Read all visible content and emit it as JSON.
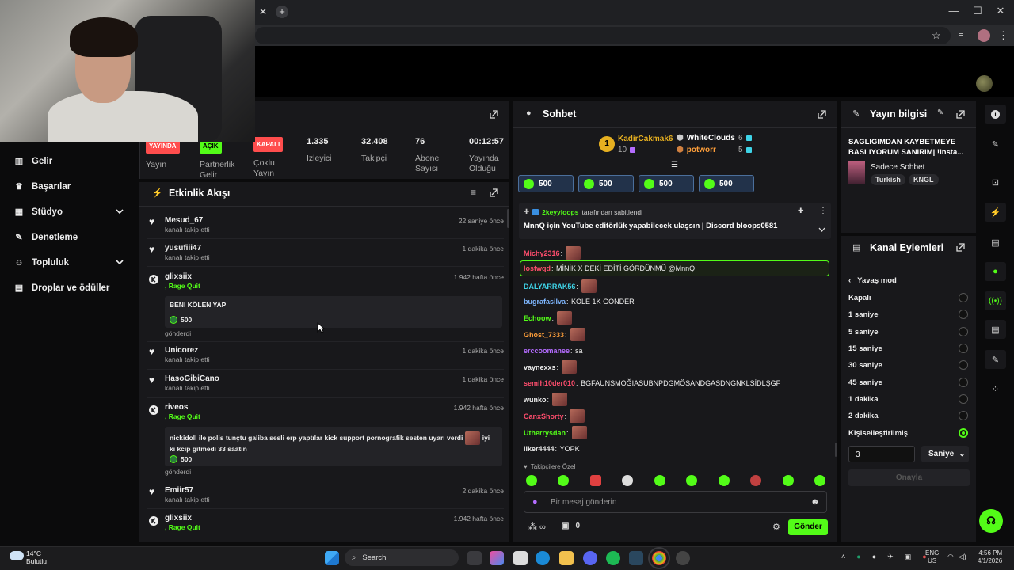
{
  "colors": {
    "accent": "#53fc18",
    "panel": "#18181b",
    "bg": "#0b0b0c"
  },
  "sidebar": {
    "items": [
      {
        "label": "Gelir",
        "icon": "bar-chart-icon"
      },
      {
        "label": "Başarılar",
        "icon": "trophy-icon"
      },
      {
        "label": "Stüdyo",
        "icon": "layout-icon"
      },
      {
        "label": "Denetleme",
        "icon": "wrench-icon"
      },
      {
        "label": "Topluluk",
        "icon": "people-icon"
      },
      {
        "label": "Droplar ve ödüller",
        "icon": "gift-icon"
      }
    ]
  },
  "stats": {
    "items": [
      {
        "badge": "YAYINDA",
        "label": "Yayın"
      },
      {
        "badge": "AÇIK",
        "label": "Partnerlik Gelir"
      },
      {
        "badge": "KAPALI",
        "label": "Çoklu Yayın"
      },
      {
        "value": "1.335",
        "label": "İzleyici"
      },
      {
        "value": "32.408",
        "label": "Takipçi"
      },
      {
        "value": "76",
        "label": "Abone Sayısı"
      },
      {
        "value": "00:12:57",
        "label": "Yayında Olduğu"
      }
    ]
  },
  "events": {
    "title": "Etkinlik Akışı",
    "items": [
      {
        "user": "Mesud_67",
        "action": "kanalı takip etti",
        "time": "22 saniye önce"
      },
      {
        "user": "yusufiii47",
        "action": "kanalı takip etti",
        "time": "1 dakika önce"
      },
      {
        "user": "glixsiix",
        "action": ", Rage Quit",
        "time": "1.942 hafta önce",
        "message": "BENİ KÖLEN YAP",
        "amount": "500",
        "sent": "gönderdi"
      },
      {
        "user": "Unicorez",
        "action": "kanalı takip etti",
        "time": "1 dakika önce"
      },
      {
        "user": "HasoGibiCano",
        "action": "kanalı takip etti",
        "time": "1 dakika önce"
      },
      {
        "user": "riveos",
        "action": ", Rage Quit",
        "time": "1.942 hafta önce",
        "message": "nickidoll ile polis tunçtu galiba sesli erp yaptılar kick support pornografik sesten uyarı verdi",
        "message2": "iyi ki kcip gitmedi 33 saatin",
        "amount": "500",
        "sent": "gönderdi"
      },
      {
        "user": "Emiir57",
        "action": "kanalı takip etti",
        "time": "2 dakika önce"
      },
      {
        "user": "glixsiix",
        "action": ", Rage Quit",
        "time": "1.942 hafta önce"
      }
    ]
  },
  "chat": {
    "title": "Sohbet",
    "leaders": [
      {
        "rank": "1",
        "name": "KadirCakmak6",
        "count": "10"
      },
      {
        "name": "WhiteClouds",
        "count": "6"
      },
      {
        "name": "potworr",
        "count": "5"
      }
    ],
    "gifts": [
      "500",
      "500",
      "500",
      "500"
    ],
    "pinned": {
      "by": "2keyyloops",
      "by_suffix": "tarafından sabitlendi",
      "text": "MnnQ için YouTube editörlük yapabilecek ulaşsın | Discord bloops0581"
    },
    "messages": [
      {
        "user": "Michy2316",
        "color": "#ff4d6d",
        "text": ""
      },
      {
        "user": "lostwqd",
        "color": "#ff4d6d",
        "text": "MİNİK X DEKİ EDİTİ GÖRDÜNMÜ @MnnQ"
      },
      {
        "user": "DALYARRAK56",
        "color": "#3ed4e8",
        "text": ""
      },
      {
        "user": "bugrafasilva",
        "color": "#7fb7ff",
        "text": "KÖLE 1K GÖNDER"
      },
      {
        "user": "Echoow",
        "color": "#53fc18",
        "text": ""
      },
      {
        "user": "Ghost_7333",
        "color": "#ff9f3a",
        "text": ""
      },
      {
        "user": "erccoomanee",
        "color": "#b46cff",
        "text": "sa"
      },
      {
        "user": "vaynexxs",
        "color": "#eeeeee",
        "text": ""
      },
      {
        "user": "semih10der010",
        "color": "#ff4d6d",
        "text": "BGFAUNSMOĞIASUBNPDGMÖSANDGASDNGNKLSİDLŞGF"
      },
      {
        "user": "wunko",
        "color": "#eeeeee",
        "text": ""
      },
      {
        "user": "CanxShorty",
        "color": "#ff4d6d",
        "text": ""
      },
      {
        "user": "Utherrysdan",
        "color": "#53fc18",
        "text": ""
      },
      {
        "user": "ilker4444",
        "color": "#eeeeee",
        "text": "YOPK"
      }
    ],
    "followers_only": "Takipçilere Özel",
    "placeholder": "Bir mesaj gönderin",
    "points": "0",
    "send_label": "Gönder"
  },
  "info": {
    "title": "Yayın bilgisi",
    "stream_title": "SAGLIGIMDAN KAYBETMEYE BASLIYORUM SANIRIM| !insta...",
    "category": "Sadece Sohbet",
    "tags": [
      "Turkish",
      "KNGL"
    ]
  },
  "actions": {
    "title": "Kanal Eylemleri",
    "back_label": "Yavaş mod",
    "options": [
      "Kapalı",
      "1 saniye",
      "5 saniye",
      "15 saniye",
      "30 saniye",
      "45 saniye",
      "1 dakika",
      "2 dakika",
      "Kişiselleştirilmiş"
    ],
    "selected": "Kişiselleştirilmiş",
    "custom_value": "3",
    "unit": "Saniye",
    "apply": "Onayla"
  },
  "taskbar": {
    "weather_temp": "14°C",
    "weather_desc": "Bulutlu",
    "search": "Search",
    "lang": "ENG",
    "lang2": "US",
    "time": "4:56 PM",
    "date": "4/1/2026"
  }
}
